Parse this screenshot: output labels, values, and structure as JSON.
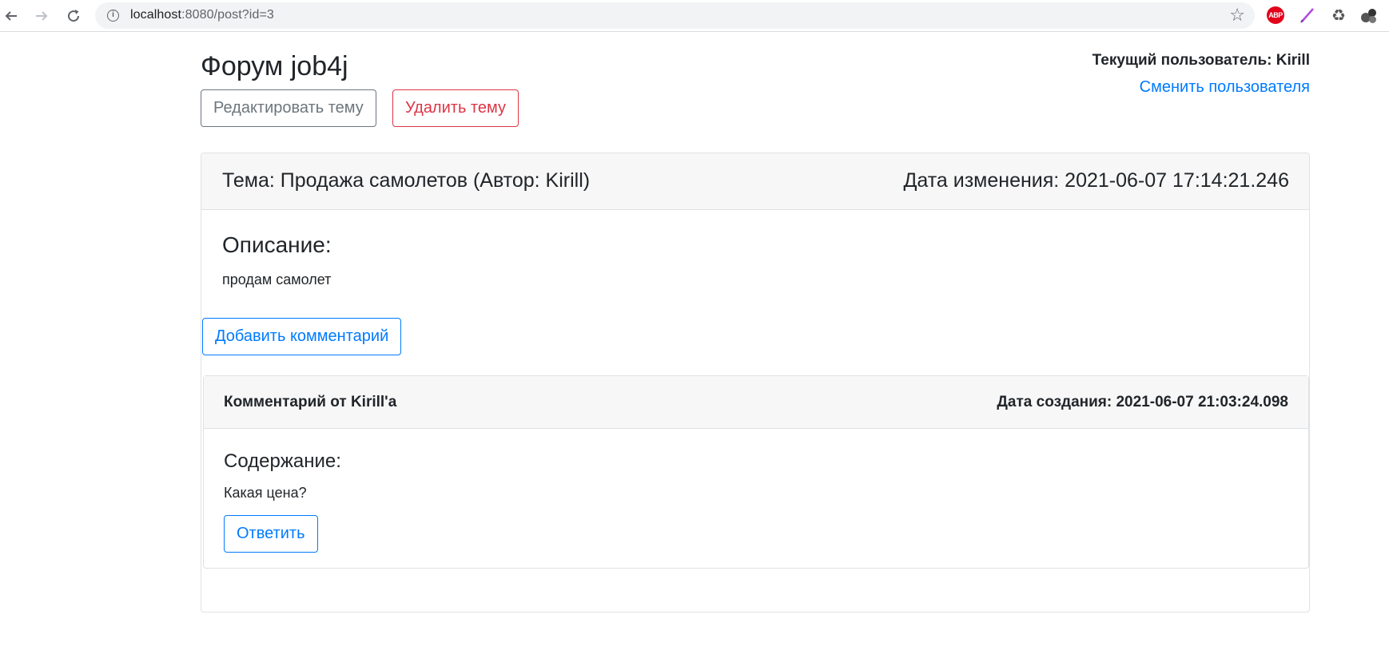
{
  "browser": {
    "url_host": "localhost",
    "url_path": ":8080/post?id=3",
    "back_icon": "arrow-left-icon",
    "forward_icon": "arrow-right-icon",
    "reload_icon": "reload-icon",
    "info_icon": "info-icon",
    "star_icon": "star-icon",
    "abp_label": "ABP",
    "extensions": [
      "adblock-plus-icon",
      "pen-icon",
      "recycle-icon",
      "extension-dots-icon"
    ]
  },
  "header": {
    "title": "Форум job4j",
    "edit_topic_button": "Редактировать тему",
    "delete_topic_button": "Удалить тему",
    "current_user": "Текущий пользователь: Kirill",
    "switch_user_link": "Сменить пользователя"
  },
  "post": {
    "topic_title": "Тема: Продажа самолетов (Автор: Kirill)",
    "modified_date": "Дата изменения: 2021-06-07 17:14:21.246",
    "description_heading": "Описание:",
    "description_text": "продам самолет",
    "add_comment_button": "Добавить комментарий"
  },
  "comments": [
    {
      "author": "Комментарий от Kirill'a",
      "created_date": "Дата создания: 2021-06-07 21:03:24.098",
      "content_heading": "Содержание:",
      "content_text": "Какая цена?",
      "reply_button": "Ответить"
    }
  ],
  "colors": {
    "primary": "#007bff",
    "danger": "#dc3545",
    "secondary": "#6c757d",
    "card_header_bg": "#f7f7f7"
  }
}
